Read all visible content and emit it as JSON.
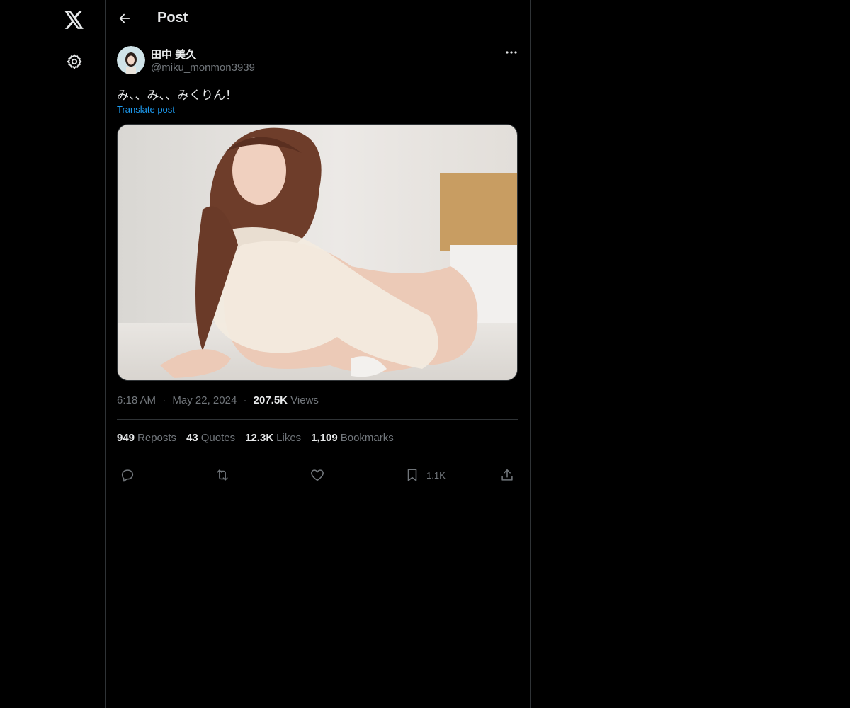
{
  "header": {
    "title": "Post"
  },
  "post": {
    "author": {
      "display_name": "田中 美久",
      "handle": "@miku_monmon3939"
    },
    "text": "み、、み、、みくりん！",
    "translate_label": "Translate post",
    "media": {
      "alt_description": "photo"
    },
    "time": "6:18 AM",
    "date": "May 22, 2024",
    "separator": "·",
    "views_count": "207.5K",
    "views_label": "Views",
    "stats": {
      "reposts": {
        "count": "949",
        "label": "Reposts"
      },
      "quotes": {
        "count": "43",
        "label": "Quotes"
      },
      "likes": {
        "count": "12.3K",
        "label": "Likes"
      },
      "bookmarks": {
        "count": "1,109",
        "label": "Bookmarks"
      }
    },
    "actions": {
      "reply_icon": "reply-icon",
      "repost_icon": "repost-icon",
      "like_icon": "heart-icon",
      "bookmark_icon": "bookmark-icon",
      "bookmark_count": "1.1K",
      "share_icon": "share-icon"
    }
  },
  "colors": {
    "background": "#000000",
    "text": "#e7e9ea",
    "secondary_text": "#71767b",
    "accent": "#1d9bf0",
    "border": "#2f3336"
  }
}
